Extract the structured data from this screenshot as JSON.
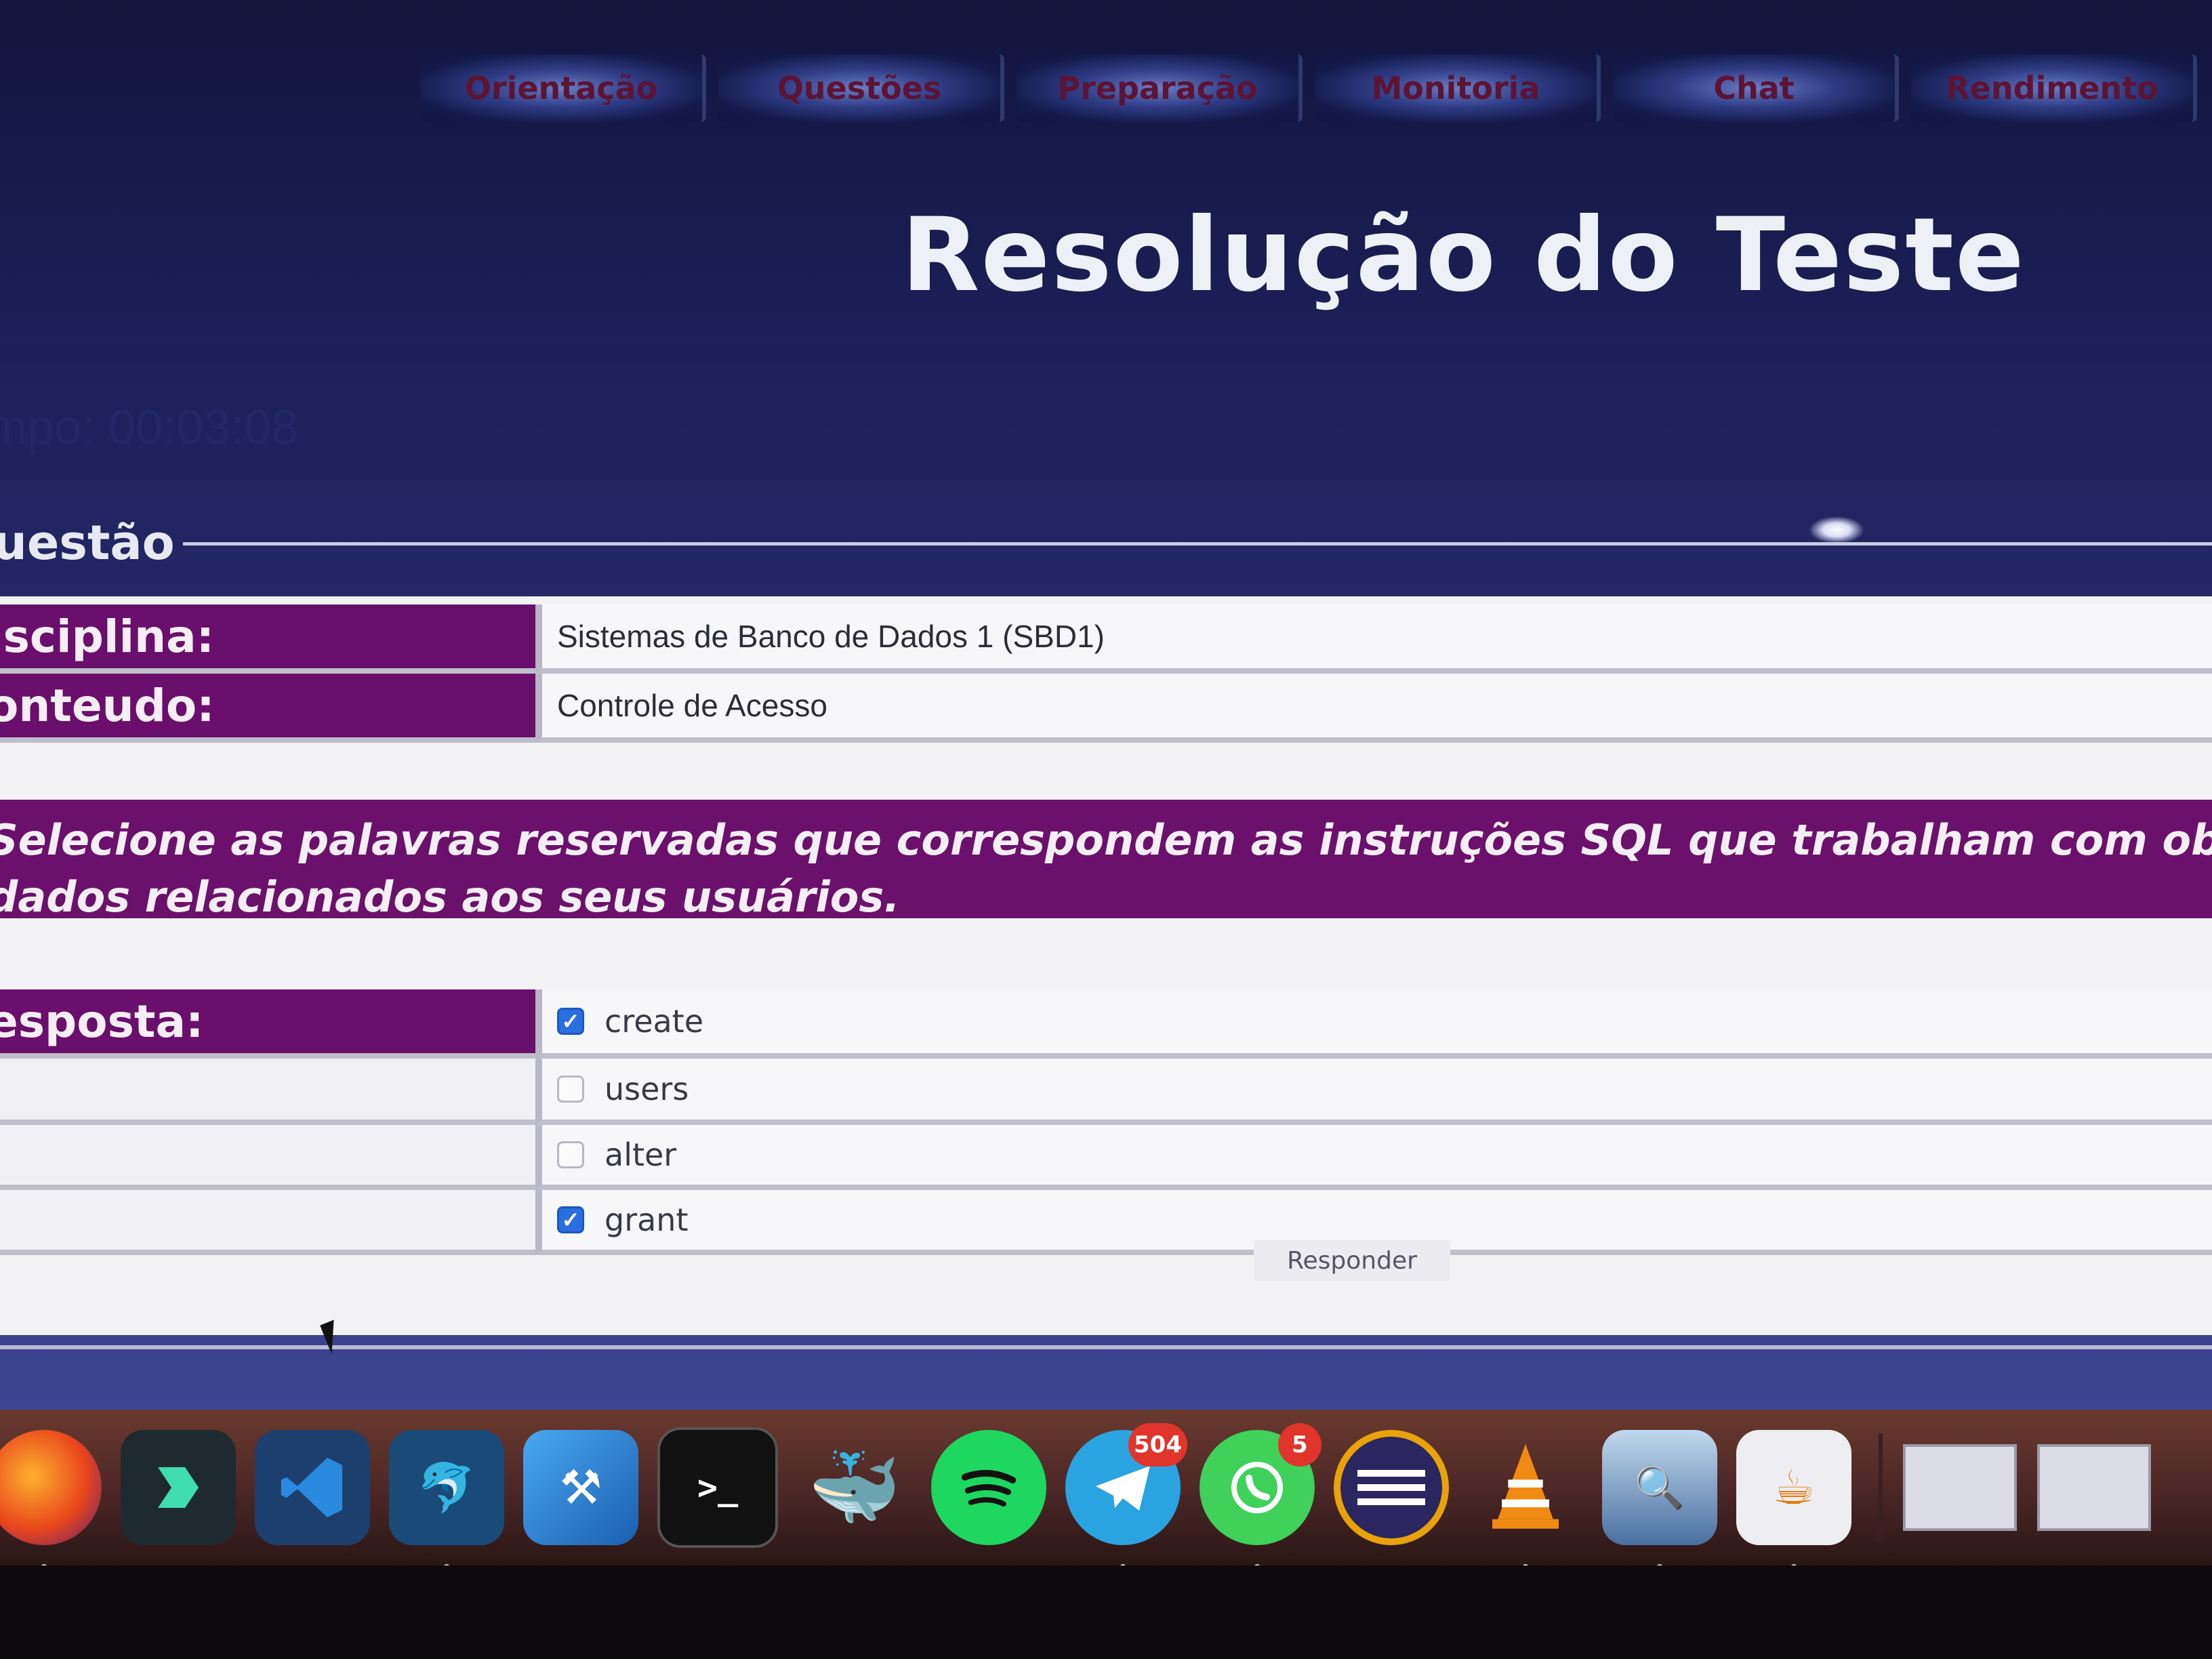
{
  "nav": {
    "items": [
      "Orientação",
      "Questões",
      "Preparação",
      "Monitoria",
      "Chat",
      "Rendimento"
    ]
  },
  "page": {
    "title": "Resolução do Teste",
    "timer": "mpo: 00:03:08"
  },
  "fieldset": {
    "legend": "uestão"
  },
  "info": {
    "disciplina_label": "isciplina:",
    "disciplina_value": "Sistemas de Banco de Dados 1 (SBD1)",
    "conteudo_label": "onteudo:",
    "conteudo_value": "Controle de Acesso"
  },
  "question": {
    "line1": "Selecione as palavras reservadas que correspondem as instruções SQL que trabalham com obj",
    "line2": "dados relacionados aos seus usuários."
  },
  "answer": {
    "label": "esposta:",
    "options": [
      {
        "text": "create",
        "checked": true
      },
      {
        "text": "users",
        "checked": false
      },
      {
        "text": "alter",
        "checked": false
      },
      {
        "text": "grant",
        "checked": true
      }
    ],
    "submit_label": "Responder"
  },
  "dock": {
    "apps": [
      {
        "name": "firefox-icon"
      },
      {
        "name": "filmora-icon"
      },
      {
        "name": "vscode-icon"
      },
      {
        "name": "mysql-workbench-icon"
      },
      {
        "name": "xcode-icon"
      },
      {
        "name": "terminal-icon",
        "glyph": ">_"
      },
      {
        "name": "docker-icon"
      },
      {
        "name": "spotify-icon"
      },
      {
        "name": "telegram-icon",
        "badge": "504"
      },
      {
        "name": "whatsapp-icon",
        "badge": "5"
      },
      {
        "name": "eclipse-icon"
      },
      {
        "name": "vlc-icon"
      },
      {
        "name": "preview-icon"
      },
      {
        "name": "java-icon"
      }
    ]
  },
  "colors": {
    "label_bg": "#6a0f6b",
    "checkbox_checked": "#2a6fe0",
    "badge": "#e0342c"
  }
}
